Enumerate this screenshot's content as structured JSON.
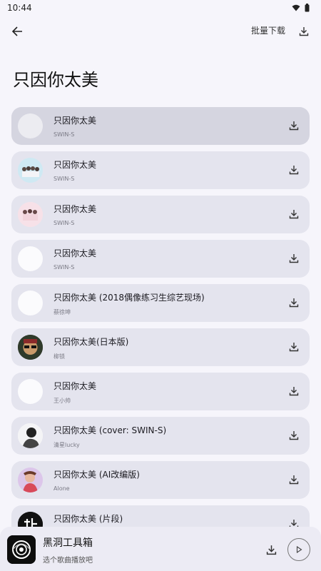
{
  "status": {
    "time": "10:44"
  },
  "header": {
    "batch_label": "批量下载",
    "title": "只因你太美"
  },
  "songs": [
    {
      "title": "只因你太美",
      "artist": "SWIN-S",
      "cover": "blank"
    },
    {
      "title": "只因你太美",
      "artist": "SWIN-S",
      "cover": "group-blue"
    },
    {
      "title": "只因你太美",
      "artist": "SWIN-S",
      "cover": "group-pink"
    },
    {
      "title": "只因你太美",
      "artist": "SWIN-S",
      "cover": "blank"
    },
    {
      "title": "只因你太美 (2018偶像练习生综艺现场)",
      "artist": "蔡徐坤",
      "cover": "blank"
    },
    {
      "title": "只因你太美(日本版)",
      "artist": "柳锁",
      "cover": "avatar-glasses"
    },
    {
      "title": "只因你太美",
      "artist": "王小帅",
      "cover": "blank"
    },
    {
      "title": "只因你太美 (cover: SWIN-S)",
      "artist": "清星lucky",
      "cover": "avatar-dark"
    },
    {
      "title": "只因你太美 (AI改编版)",
      "artist": "Alone",
      "cover": "avatar-pink"
    },
    {
      "title": "只因你太美 (片段)",
      "artist": "",
      "cover": "douyin"
    }
  ],
  "player": {
    "title": "黑洞工具箱",
    "subtitle": "选个歌曲播放吧"
  },
  "colors": {
    "background": "#f6f5fb",
    "card": "#e4e4ee",
    "card_selected": "#d5d5e0",
    "player_bar": "#ecebf4"
  },
  "icons": {
    "back": "arrow-left-icon",
    "download": "download-icon",
    "play": "play-icon",
    "wifi": "wifi-icon",
    "battery": "battery-icon"
  }
}
